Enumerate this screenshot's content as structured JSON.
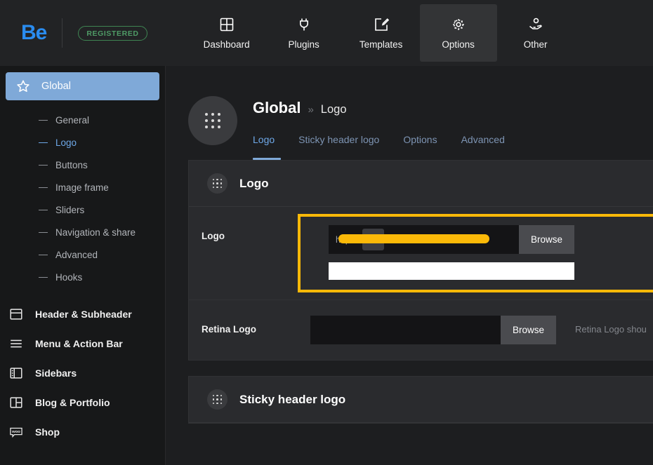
{
  "topbar": {
    "brand": "Be",
    "badge": "REGISTERED",
    "nav": [
      {
        "label": "Dashboard",
        "icon": "grid-icon",
        "active": false
      },
      {
        "label": "Plugins",
        "icon": "plug-icon",
        "active": false
      },
      {
        "label": "Templates",
        "icon": "template-edit-icon",
        "active": false
      },
      {
        "label": "Options",
        "icon": "gear-icon",
        "active": true
      },
      {
        "label": "Other",
        "icon": "hand-user-icon",
        "active": false
      }
    ]
  },
  "sidebar": {
    "active_group": {
      "label": "Global",
      "icon": "star-icon"
    },
    "sub_items": [
      {
        "label": "General",
        "current": false
      },
      {
        "label": "Logo",
        "current": true
      },
      {
        "label": "Buttons",
        "current": false
      },
      {
        "label": "Image frame",
        "current": false
      },
      {
        "label": "Sliders",
        "current": false
      },
      {
        "label": "Navigation & share",
        "current": false
      },
      {
        "label": "Advanced",
        "current": false
      },
      {
        "label": "Hooks",
        "current": false
      }
    ],
    "main_items": [
      {
        "label": "Header & Subheader",
        "icon": "header-layout-icon"
      },
      {
        "label": "Menu & Action Bar",
        "icon": "hamburger-icon"
      },
      {
        "label": "Sidebars",
        "icon": "sidebar-layout-icon"
      },
      {
        "label": "Blog & Portfolio",
        "icon": "columns-layout-icon"
      },
      {
        "label": "Shop",
        "icon": "woo-icon"
      }
    ]
  },
  "main": {
    "breadcrumb": {
      "root": "Global",
      "separator": "»",
      "leaf": "Logo"
    },
    "tabs": [
      {
        "label": "Logo",
        "active": true
      },
      {
        "label": "Sticky header logo",
        "active": false
      },
      {
        "label": "Options",
        "active": false
      },
      {
        "label": "Advanced",
        "active": false
      }
    ],
    "panels": [
      {
        "title": "Logo",
        "rows": [
          {
            "label": "Logo",
            "highlighted": true,
            "url_value": "https://",
            "url_redacted": true,
            "browse_label": "Browse",
            "trash_icon": "trash-icon",
            "second_input_value": "",
            "helper": ""
          },
          {
            "label": "Retina Logo",
            "highlighted": false,
            "url_value": "",
            "url_redacted": false,
            "browse_label": "Browse",
            "second_input_value": null,
            "helper": "Retina Logo shou"
          }
        ]
      },
      {
        "title": "Sticky header logo",
        "rows": []
      }
    ]
  },
  "colors": {
    "accent_blue": "#6ea8e8",
    "active_sidebar": "#7fa9d8",
    "highlight_yellow": "#fbb908",
    "badge_green": "#4f9b66",
    "brand_blue": "#2a8cf0"
  }
}
